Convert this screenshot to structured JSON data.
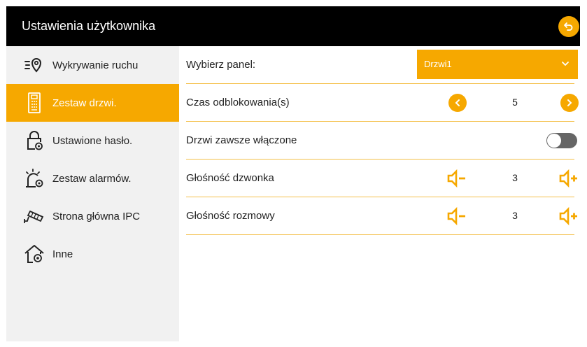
{
  "header": {
    "title": "Ustawienia użytkownika"
  },
  "sidebar": {
    "items": [
      {
        "label": "Wykrywanie ruchu",
        "icon": "motion-detection-icon"
      },
      {
        "label": "Zestaw drzwi.",
        "icon": "door-panel-icon",
        "active": true
      },
      {
        "label": "Ustawione hasło.",
        "icon": "lock-settings-icon"
      },
      {
        "label": "Zestaw alarmów.",
        "icon": "alarm-settings-icon"
      },
      {
        "label": "Strona główna IPC",
        "icon": "ip-camera-icon"
      },
      {
        "label": "Inne",
        "icon": "home-settings-icon"
      }
    ]
  },
  "settings": {
    "panel": {
      "label": "Wybierz panel:",
      "value": "Drzwi1"
    },
    "unlock_time": {
      "label": "Czas odblokowania(s)",
      "value": "5"
    },
    "always_on": {
      "label": "Drzwi zawsze włączone",
      "enabled": false
    },
    "ring_volume": {
      "label": "Głośność dzwonka",
      "value": "3"
    },
    "talk_volume": {
      "label": "Głośność rozmowy",
      "value": "3"
    }
  },
  "colors": {
    "accent": "#f6a800",
    "header_bg": "#000000",
    "sidebar_bg": "#f1f1f1",
    "toggle_off": "#666666"
  }
}
